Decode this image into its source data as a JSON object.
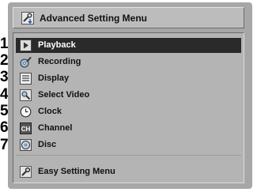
{
  "numbers": [
    "1",
    "2",
    "3",
    "4",
    "5",
    "6",
    "7"
  ],
  "title": {
    "text": "Advanced Setting Menu",
    "icon": "wrench-arrow-icon"
  },
  "menu": {
    "selected_index": 0,
    "items": [
      {
        "label": "Playback",
        "icon": "play-icon"
      },
      {
        "label": "Recording",
        "icon": "disc-pen-icon"
      },
      {
        "label": "Display",
        "icon": "display-icon"
      },
      {
        "label": "Select Video",
        "icon": "magnifier-icon"
      },
      {
        "label": "Clock",
        "icon": "clock-icon"
      },
      {
        "label": "Channel",
        "icon": "ch-icon"
      },
      {
        "label": "Disc",
        "icon": "disc-icon"
      }
    ],
    "footer": {
      "label": "Easy Setting Menu",
      "icon": "wrench-icon"
    }
  },
  "colors": {
    "selected_bg": "#2a2a2a",
    "frame": "#a7a7a7",
    "panel": "#b4b4b4"
  }
}
